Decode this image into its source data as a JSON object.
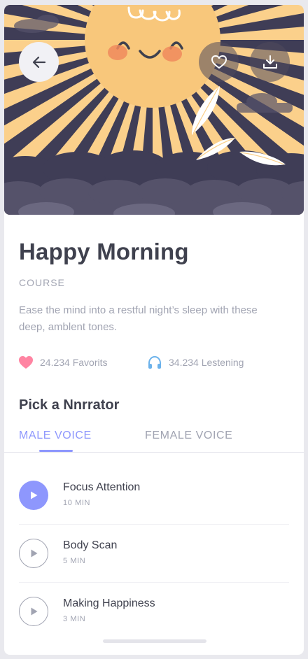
{
  "course": {
    "title": "Happy Morning",
    "category": "COURSE",
    "description": "Ease the mind into a restful night’s sleep  with these deep, amblent tones."
  },
  "stats": {
    "favorites": "24.234 Favorits",
    "listening": "34.234 Lestening"
  },
  "narrator": {
    "heading": "Pick a Nnrrator",
    "tabs": [
      {
        "label": "MALE VOICE",
        "active": true
      },
      {
        "label": "FEMALE VOICE",
        "active": false
      }
    ]
  },
  "tracks": [
    {
      "name": "Focus Attention",
      "duration": "10 MIN",
      "playing": true
    },
    {
      "name": "Body Scan",
      "duration": "5 MIN",
      "playing": false
    },
    {
      "name": "Making Happiness",
      "duration": "3 MIN",
      "playing": false
    }
  ],
  "icons": {
    "back": "arrow-left-icon",
    "favorite": "heart-outline-icon",
    "download": "download-icon",
    "stat_favorite": "heart-icon",
    "stat_listening": "headphones-icon",
    "play": "play-icon"
  },
  "colors": {
    "accent": "#8e97fd",
    "heart": "#ff84a2",
    "headphones": "#6cb2eb",
    "sun": "#f8c77b",
    "sky": "#3f3d56",
    "text_primary": "#3f414e",
    "text_secondary": "#a1a4b2"
  }
}
